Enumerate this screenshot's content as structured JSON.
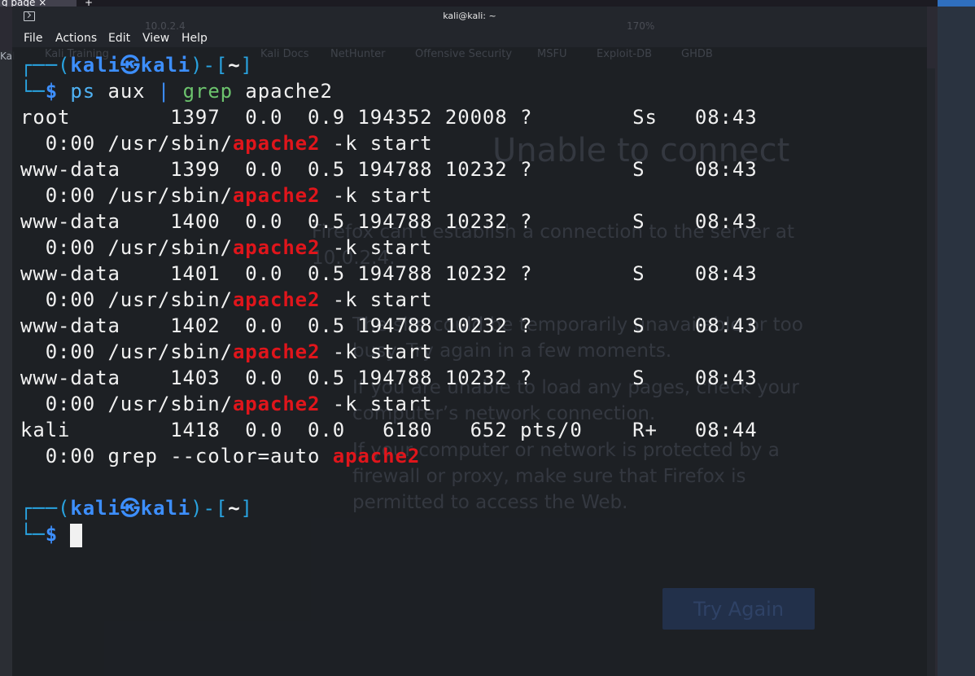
{
  "browser_bg": {
    "tab_label": "g page",
    "tab_close": "×",
    "new_tab": "+",
    "url_text": "10.0.2.4",
    "zoom": "170%",
    "bookmarks": [
      "Kali Training",
      "Kali Docs",
      "NetHunter",
      "Offensive Security",
      "MSFU",
      "Exploit-DB",
      "GHDB"
    ],
    "left_strip_text": "Kal",
    "error_title": "Unable to connect",
    "error_lines": [
      "Firefox can’t establish a connection to the server at",
      "10.0.2.4.",
      "The site could be temporarily unavailable or too",
      "busy. Try again in a few moments.",
      "If you are unable to load any pages, check your",
      "computer’s network connection.",
      "If your computer or network is protected by a",
      "firewall or proxy, make sure that Firefox is",
      "permitted to access the Web."
    ],
    "try_again": "Try Again"
  },
  "window": {
    "title": "kali@kali: ~"
  },
  "menu": [
    "File",
    "Actions",
    "Edit",
    "View",
    "Help"
  ],
  "prompt": {
    "top_left": "┌──(",
    "user": "kali",
    "at": "㉿",
    "host": "kali",
    "mid": ")-[",
    "dir": "~",
    "end": "]",
    "bottom_left": "└─",
    "dollar": "$"
  },
  "command": {
    "cmd": "ps",
    "arg1": "aux",
    "pipe": "|",
    "grep": "grep",
    "arg2": "apache2"
  },
  "output": [
    {
      "line1": "root        1397  0.0  0.9 194352 20008 ?        Ss   08:43",
      "pre": "  0:00 /usr/sbin/",
      "hl": "apache2",
      "post": " -k start"
    },
    {
      "line1": "www-data    1399  0.0  0.5 194788 10232 ?        S    08:43",
      "pre": "  0:00 /usr/sbin/",
      "hl": "apache2",
      "post": " -k start"
    },
    {
      "line1": "www-data    1400  0.0  0.5 194788 10232 ?        S    08:43",
      "pre": "  0:00 /usr/sbin/",
      "hl": "apache2",
      "post": " -k start"
    },
    {
      "line1": "www-data    1401  0.0  0.5 194788 10232 ?        S    08:43",
      "pre": "  0:00 /usr/sbin/",
      "hl": "apache2",
      "post": " -k start"
    },
    {
      "line1": "www-data    1402  0.0  0.5 194788 10232 ?        S    08:43",
      "pre": "  0:00 /usr/sbin/",
      "hl": "apache2",
      "post": " -k start"
    },
    {
      "line1": "www-data    1403  0.0  0.5 194788 10232 ?        S    08:43",
      "pre": "  0:00 /usr/sbin/",
      "hl": "apache2",
      "post": " -k start"
    },
    {
      "line1": "kali        1418  0.0  0.0   6180   652 pts/0    R+   08:44",
      "pre": "  0:00 grep --color=auto ",
      "hl": "apache2",
      "post": ""
    }
  ]
}
